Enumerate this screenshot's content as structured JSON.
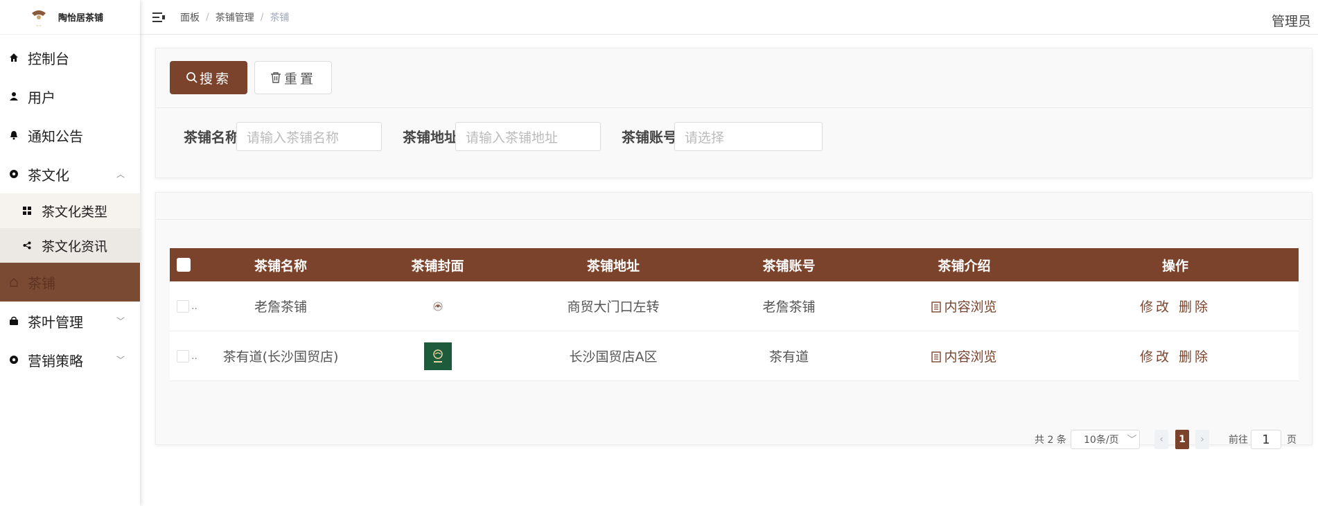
{
  "app": {
    "logo_text": "陶怡居茶铺"
  },
  "sidebar": {
    "items": [
      {
        "label": "控制台",
        "icon": "home-icon"
      },
      {
        "label": "用户",
        "icon": "user-icon"
      },
      {
        "label": "通知公告",
        "icon": "bell-icon"
      },
      {
        "label": "茶文化",
        "icon": "gear-icon",
        "expanded": true,
        "children": [
          {
            "label": "茶文化类型",
            "icon": "grid-icon"
          },
          {
            "label": "茶文化资讯",
            "icon": "share-icon"
          }
        ]
      },
      {
        "label": "茶铺",
        "icon": "house-outline-icon",
        "active": true
      },
      {
        "label": "茶叶管理",
        "icon": "bag-icon",
        "expanded": false
      },
      {
        "label": "营销策略",
        "icon": "gear-icon",
        "expanded": false
      }
    ]
  },
  "header": {
    "breadcrumb": [
      "面板",
      "茶铺管理",
      "茶铺"
    ],
    "user": "管理员"
  },
  "search": {
    "search_label": "搜索",
    "reset_label": "重置",
    "fields": [
      {
        "label": "茶铺名称",
        "placeholder": "请输入茶铺名称"
      },
      {
        "label": "茶铺地址",
        "placeholder": "请输入茶铺地址"
      },
      {
        "label": "茶铺账号",
        "placeholder": "请选择"
      }
    ]
  },
  "table": {
    "columns": [
      "茶铺名称",
      "茶铺封面",
      "茶铺地址",
      "茶铺账号",
      "茶铺介绍",
      "操作"
    ],
    "rows": [
      {
        "name": "老詹茶铺",
        "address": "商贸大门口左转",
        "account": "老詹茶铺",
        "intro": "内容浏览",
        "edit": "修改",
        "delete": "删除"
      },
      {
        "name": "茶有道(长沙国贸店)",
        "address": "长沙国贸店A区",
        "account": "茶有道",
        "intro": "内容浏览",
        "edit": "修改",
        "delete": "删除"
      }
    ]
  },
  "pagination": {
    "total": "共 2 条",
    "page_size": "10条/页",
    "current": "1",
    "goto_prefix": "前往",
    "goto_value": "1",
    "goto_suffix": "页"
  },
  "colors": {
    "accent": "#7b432c",
    "active_nav": "#7b4a33"
  }
}
